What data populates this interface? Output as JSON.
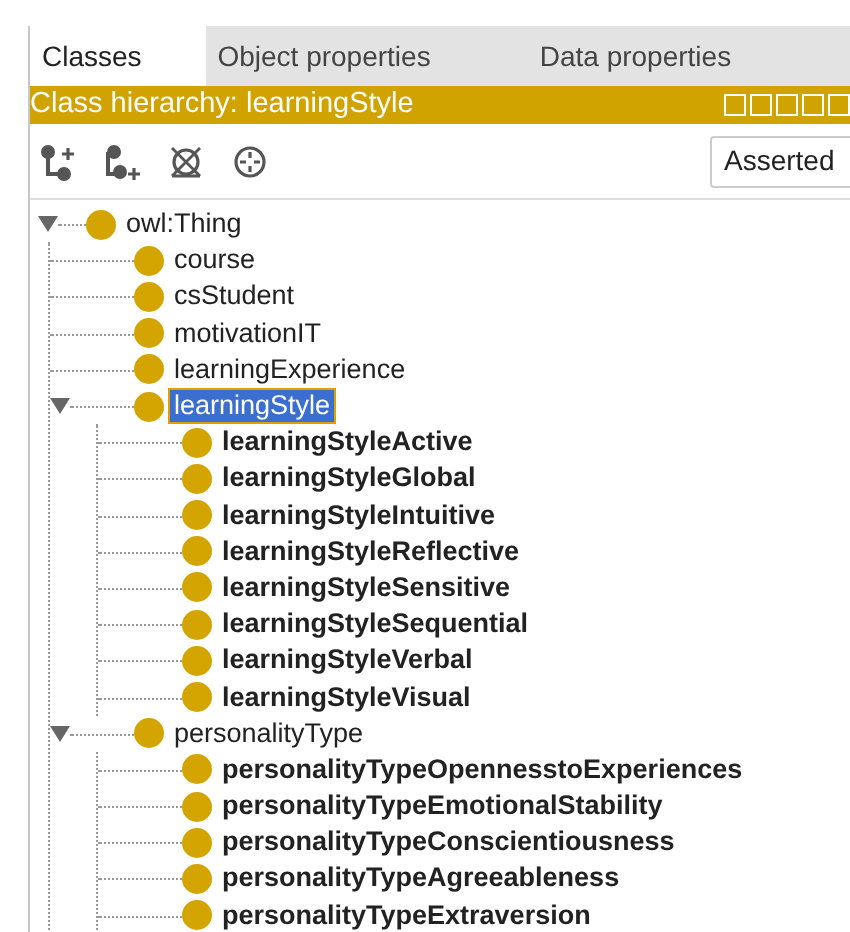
{
  "tabs": [
    {
      "label": "Classes",
      "selected": true
    },
    {
      "label": "Object properties",
      "selected": false
    },
    {
      "label": "Data properties",
      "selected": false
    }
  ],
  "view_header": {
    "title": "Class hierarchy: learningStyle"
  },
  "hierarchy_mode": {
    "value": "Asserted"
  },
  "tree": [
    {
      "label": "owl:Thing",
      "bold": false,
      "selected": false,
      "expanded": true,
      "children": [
        {
          "label": "course",
          "bold": false,
          "selected": false
        },
        {
          "label": "csStudent",
          "bold": false,
          "selected": false
        },
        {
          "label": "motivationIT",
          "bold": false,
          "selected": false
        },
        {
          "label": "learningExperience",
          "bold": false,
          "selected": false
        },
        {
          "label": "learningStyle",
          "bold": false,
          "selected": true,
          "expanded": true,
          "children": [
            {
              "label": "learningStyleActive",
              "bold": true,
              "selected": false
            },
            {
              "label": "learningStyleGlobal",
              "bold": true,
              "selected": false
            },
            {
              "label": "learningStyleIntuitive",
              "bold": true,
              "selected": false
            },
            {
              "label": "learningStyleReflective",
              "bold": true,
              "selected": false
            },
            {
              "label": "learningStyleSensitive",
              "bold": true,
              "selected": false
            },
            {
              "label": "learningStyleSequential",
              "bold": true,
              "selected": false
            },
            {
              "label": "learningStyleVerbal",
              "bold": true,
              "selected": false
            },
            {
              "label": "learningStyleVisual",
              "bold": true,
              "selected": false
            }
          ]
        },
        {
          "label": "personalityType",
          "bold": false,
          "selected": false,
          "expanded": true,
          "children": [
            {
              "label": "personalityTypeOpennesstoExperiences",
              "bold": true,
              "selected": false
            },
            {
              "label": "personalityTypeEmotionalStability",
              "bold": true,
              "selected": false
            },
            {
              "label": "personalityTypeConscientiousness",
              "bold": true,
              "selected": false
            },
            {
              "label": "personalityTypeAgreeableness",
              "bold": true,
              "selected": false
            },
            {
              "label": "personalityTypeExtraversion",
              "bold": true,
              "selected": false
            }
          ]
        }
      ]
    }
  ]
}
